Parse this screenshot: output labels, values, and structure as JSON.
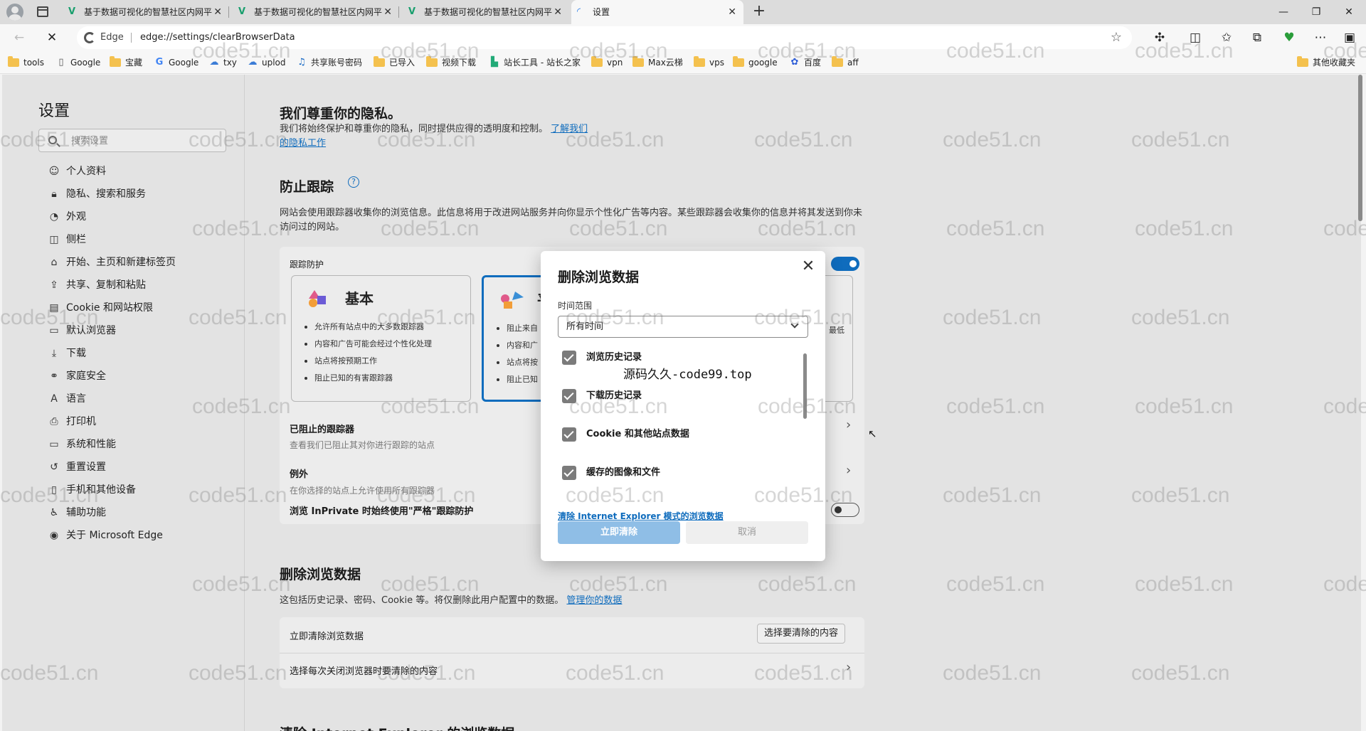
{
  "browser": {
    "tabs": [
      {
        "title": "基于数据可视化的智慧社区内网平台",
        "favicon": "V"
      },
      {
        "title": "基于数据可视化的智慧社区内网平台",
        "favicon": "V"
      },
      {
        "title": "基于数据可视化的智慧社区内网平台",
        "favicon": "V"
      },
      {
        "title": "设置",
        "favicon": "loading"
      }
    ],
    "brand": "Edge",
    "url": "edge://settings/clearBrowserData",
    "bookmarks": [
      "tools",
      "Google",
      "宝藏",
      "Google",
      "txy",
      "uplod",
      "共享账号密码",
      "已导入",
      "视频下载",
      "站长工具 - 站长之家",
      "vpn",
      "Max云梯",
      "vps",
      "google",
      "百度",
      "aff"
    ],
    "other_bookmarks": "其他收藏夹"
  },
  "settings": {
    "title": "设置",
    "search_placeholder": "搜索设置",
    "nav": [
      {
        "label": "个人资料",
        "icon": "person-icon"
      },
      {
        "label": "隐私、搜索和服务",
        "icon": "lock-icon"
      },
      {
        "label": "外观",
        "icon": "palette-icon"
      },
      {
        "label": "侧栏",
        "icon": "sidebar-icon"
      },
      {
        "label": "开始、主页和新建标签页",
        "icon": "home-icon"
      },
      {
        "label": "共享、复制和粘贴",
        "icon": "share-icon"
      },
      {
        "label": "Cookie 和网站权限",
        "icon": "cookie-icon"
      },
      {
        "label": "默认浏览器",
        "icon": "browser-icon"
      },
      {
        "label": "下载",
        "icon": "download-icon"
      },
      {
        "label": "家庭安全",
        "icon": "family-icon"
      },
      {
        "label": "语言",
        "icon": "language-icon"
      },
      {
        "label": "打印机",
        "icon": "printer-icon"
      },
      {
        "label": "系统和性能",
        "icon": "laptop-icon"
      },
      {
        "label": "重置设置",
        "icon": "reset-icon"
      },
      {
        "label": "手机和其他设备",
        "icon": "phone-icon"
      },
      {
        "label": "辅助功能",
        "icon": "accessibility-icon"
      },
      {
        "label": "关于 Microsoft Edge",
        "icon": "edge-icon"
      }
    ],
    "privacy_heading": "我们尊重你的隐私。",
    "privacy_text": "我们将始终保护和尊重你的隐私，同时提供应得的透明度和控制。",
    "privacy_link": "了解我们的隐私工作",
    "tracking_heading": "防止跟踪",
    "tracking_text": "网站会使用跟踪器收集你的浏览信息。此信息将用于改进网站服务并向你显示个性化广告等内容。某些跟踪器会收集你的信息并将其发送到你未访问过的网站。",
    "tracking_card_label": "跟踪防护",
    "basic": {
      "name": "基本",
      "items": [
        "允许所有站点中的大多数跟踪器",
        "内容和广告可能会经过个性化处理",
        "站点将按预期工作",
        "阻止已知的有害跟踪器"
      ]
    },
    "balanced": {
      "name": "平",
      "items": [
        "阻止来自",
        "内容和广",
        "站点将按",
        "阻止已知"
      ]
    },
    "strict_partial": "最低",
    "blocked_label": "已阻止的跟踪器",
    "blocked_sub": "查看我们已阻止其对你进行跟踪的站点",
    "exceptions_label": "例外",
    "exceptions_sub": "在你选择的站点上允许使用所有跟踪器",
    "inprivate_label": "浏览 InPrivate 时始终使用\"严格\"跟踪防护",
    "clear_heading": "删除浏览数据",
    "clear_text": "这包括历史记录、密码、Cookie 等。将仅删除此用户配置中的数据。",
    "clear_link": "管理你的数据",
    "clear_now_label": "立即清除浏览数据",
    "choose_button": "选择要清除的内容",
    "on_close_label": "选择每次关闭浏览器时要清除的内容",
    "ie_partial": "清除 Internet Explorer 的浏览数据"
  },
  "dialog": {
    "title": "删除浏览数据",
    "range_label": "时间范围",
    "range_value": "所有时间",
    "items": [
      {
        "label": "浏览历史记录",
        "checked": true
      },
      {
        "label": "下载历史记录",
        "checked": true
      },
      {
        "label": "Cookie 和其他站点数据",
        "checked": true
      },
      {
        "label": "缓存的图像和文件",
        "checked": true
      }
    ],
    "ie_link": "清除 Internet Explorer 模式的浏览数据",
    "confirm": "立即清除",
    "cancel": "取消"
  },
  "overlay_text": "源码久久-code99.top",
  "watermark": "code51.cn",
  "colors": {
    "accent": "#0f6cbd",
    "disabled_primary": "#8fbee6"
  }
}
